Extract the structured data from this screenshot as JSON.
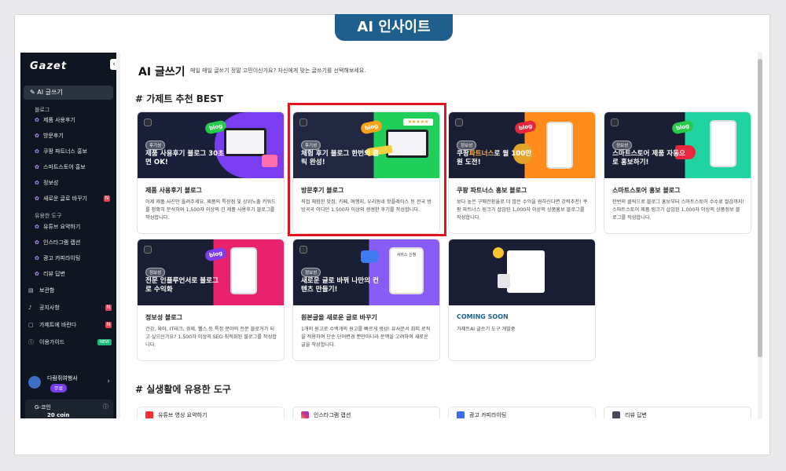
{
  "banner": "AI 인사이트",
  "sidebar": {
    "logo": "Gazet",
    "active": "AI 글쓰기",
    "group_blog": "블로그",
    "blog_items": [
      "제품 사용후기",
      "방문후기",
      "쿠팡 파트너스 홍보",
      "스마트스토어 홍보",
      "정보성",
      "새로운 글로 바꾸기"
    ],
    "badge_n": "N",
    "group_tools": "유용한 도구",
    "tool_items": [
      "유튜브 요약하기",
      "인스타그램 캡션",
      "광고 카피라이팅",
      "리뷰 답변"
    ],
    "main_items": [
      "보관함",
      "공지사항",
      "가제트에 바란다",
      "이용가이드"
    ],
    "badge_new": "NEW",
    "user_name": "다람쥐여행사",
    "user_tag": "무료",
    "coin_label": "G-코인",
    "coin_value": "20 coin"
  },
  "main": {
    "title": "AI 글쓰기",
    "subtitle": "매일 매일 글쓰기 정말 고민이신가요? 자신에게 맞는 글쓰기를 선택해보세요.",
    "section_best": "# 가제트 추천 BEST",
    "section_tools": "# 실생활에 유용한 도구",
    "cards": [
      {
        "tag": "후기성",
        "headline": "제품 사용후기 블로그 30초면 OK!",
        "title": "제품 사용후기 블로그",
        "desc": "이제 제품 사진만 올려주세요. 제품의 특장점 및 상위노출 키워드를 정확히 분석하여 1,500자 이상의 긴 제품 사용후기 블로그를 작성합니다."
      },
      {
        "tag": "후기성",
        "headline": "체험 후기 블로그 한번의 클릭 완성!",
        "title": "방문후기 블로그",
        "desc": "직접 체험한 맛집, 카페, 여행지, 우리동네 핫플레이스 등 전국 방방곡곡 어디던 1,500자 이상의 생생한 후기를 작성합니다."
      },
      {
        "tag": "정보성",
        "headline_pre": "쿠팡",
        "headline_accent": "파트너스",
        "headline_post": "로 월 100만원 도전!",
        "title": "쿠팡 파트너스 홍보 블로그",
        "desc": "보다 높은 구매전환율로 더 많은 수익을 원하신다면 강력추천! 쿠팡 파트너스 링크가 삽입된 1,000자 이상의 상품홍보 블로그를 작성합니다."
      },
      {
        "tag": "정보성",
        "headline": "스마트스토어 제품 자동으로 홍보하기!",
        "title": "스마트스토어 홍보 블로그",
        "desc": "한번의 클릭으로 블로그 홍보부터 스마트스토어 수수료 절감까지! 스마트스토어 제품 링크가 삽입된 1,000자 이상의 상품정보 블로그를 작성합니다."
      },
      {
        "tag": "정보성",
        "headline": "전문 인플루언서로 블로그로 수익화",
        "title": "정보성 블로그",
        "desc": "건강, 육아, IT테크, 경제, 웰스 등 특정 분야의 전문 블로거가 되고 싶으신가요? 1,500자 이상의 SEO 최적화된 블로그를 작성합니다."
      },
      {
        "tag": "정보성",
        "headline": "새로운 글로 바꿔 나만의 컨텐츠 만들기!",
        "title": "원본글을 새로운 글로 바꾸기",
        "desc": "1개의 원고로 수백개의 원고를 빠르게 생성! 유사문서 회피 로직을 적용하여 단순 단어변경 뿐만아니라 문맥을 고려하여 새로운 글을 작성합니다."
      },
      {
        "title": "COMING SOON",
        "desc": "가제트AI 글쓰기 도구 개발중"
      }
    ],
    "blog_word": "blog",
    "thumb_label": "서비스 신청"
  },
  "tools": [
    "유튜브 영상 요약하기",
    "인스타그램 캡션",
    "광고 카피라이팅",
    "리뷰 답변"
  ],
  "colors": {
    "sidebar": "#0f1621",
    "accent": "#7a3df0",
    "banner": "#1f5f8e",
    "highlight": "#e0141e"
  }
}
